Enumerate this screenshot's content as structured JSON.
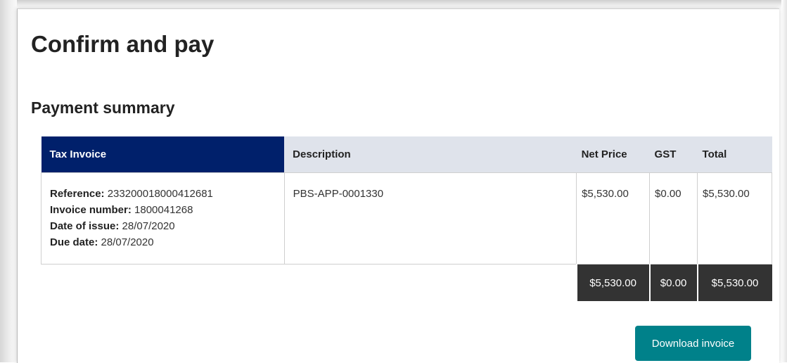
{
  "page": {
    "title": "Confirm and pay",
    "section_title": "Payment summary"
  },
  "table": {
    "headers": {
      "tax_invoice": "Tax Invoice",
      "description": "Description",
      "net_price": "Net Price",
      "gst": "GST",
      "total": "Total"
    },
    "invoice": {
      "reference_label": "Reference:",
      "reference_value": "233200018000412681",
      "invoice_number_label": "Invoice number:",
      "invoice_number_value": "1800041268",
      "date_of_issue_label": "Date of issue:",
      "date_of_issue_value": "28/07/2020",
      "due_date_label": "Due date:",
      "due_date_value": "28/07/2020"
    },
    "row": {
      "description": "PBS-APP-0001330",
      "net_price": "$5,530.00",
      "gst": "$0.00",
      "total": "$5,530.00"
    },
    "totals": {
      "net_price": "$5,530.00",
      "gst": "$0.00",
      "total": "$5,530.00"
    }
  },
  "actions": {
    "download_invoice": "Download invoice"
  },
  "colors": {
    "tax_invoice_header": "#00206b",
    "table_header": "#dfe3eb",
    "totals_background": "#333333",
    "download_button": "#00818a"
  }
}
